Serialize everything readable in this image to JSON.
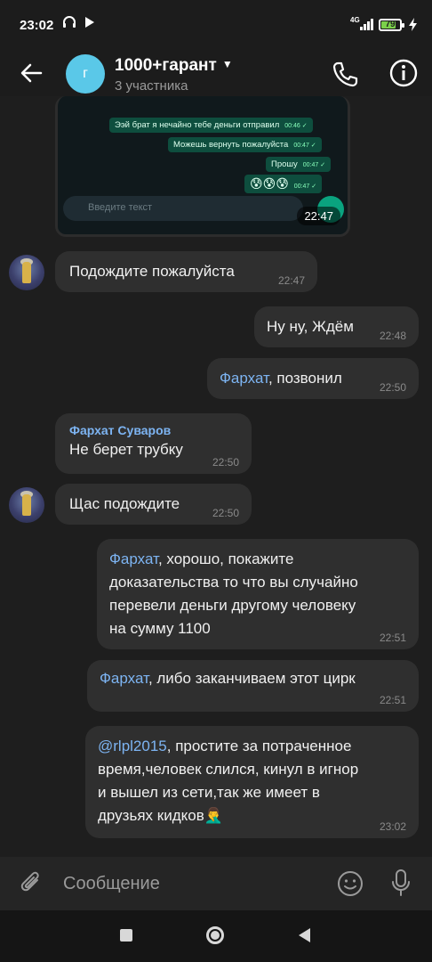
{
  "status_bar": {
    "time": "23:02",
    "network": "4G",
    "battery": "79",
    "battery_level": 0.79
  },
  "header": {
    "avatar_letter": "г",
    "title": "1000+гарант",
    "subtitle": "3 участника"
  },
  "image_message": {
    "time": "22:47",
    "inner_bubbles": [
      {
        "text": "Ээй  брат я нечайно тебе деньги отправил",
        "time": "00:46 ✓"
      },
      {
        "text": "Можешь вернуть пожалуйста",
        "time": "00:47 ✓"
      },
      {
        "text": "Прошу",
        "time": "00:47 ✓"
      },
      {
        "text": "😰😰😰",
        "time": "00:47 ✓"
      }
    ],
    "input_placeholder": "Введите текст"
  },
  "messages": [
    {
      "text": "Подождите пожалуйста",
      "time": "22:47"
    },
    {
      "text": "Ну ну, Ждём",
      "time": "22:48"
    },
    {
      "mention": "Фархат",
      "text": ", позвонил",
      "time": "22:50"
    },
    {
      "sender": "Фархат Суваров",
      "text": "Не берет трубку",
      "time": "22:50"
    },
    {
      "text": "Щас подождите",
      "time": "22:50"
    },
    {
      "mention": "Фархат",
      "text_lines": [
        ", хорошо, покажите",
        "доказательства то что вы случайно",
        "перевели деньги другому человеку",
        "на сумму 1100"
      ],
      "time": "22:51"
    },
    {
      "mention": "Фархат",
      "text": ", либо заканчиваем этот цирк",
      "time": "22:51"
    },
    {
      "mention": "@rlpl2015",
      "text_lines": [
        ", простите за потраченное",
        "время,человек слился, кинул в игнор",
        "и вышел из сети,так же имеет в",
        "друзьях кидков"
      ],
      "emoji": "🤦‍♂️",
      "time": "23:02"
    }
  ],
  "composer": {
    "placeholder": "Сообщение"
  },
  "colors": {
    "background": "#1e1e1e",
    "bubble": "#2f2f2f",
    "mention": "#7db4f2",
    "avatar": "#5ac8e8"
  }
}
